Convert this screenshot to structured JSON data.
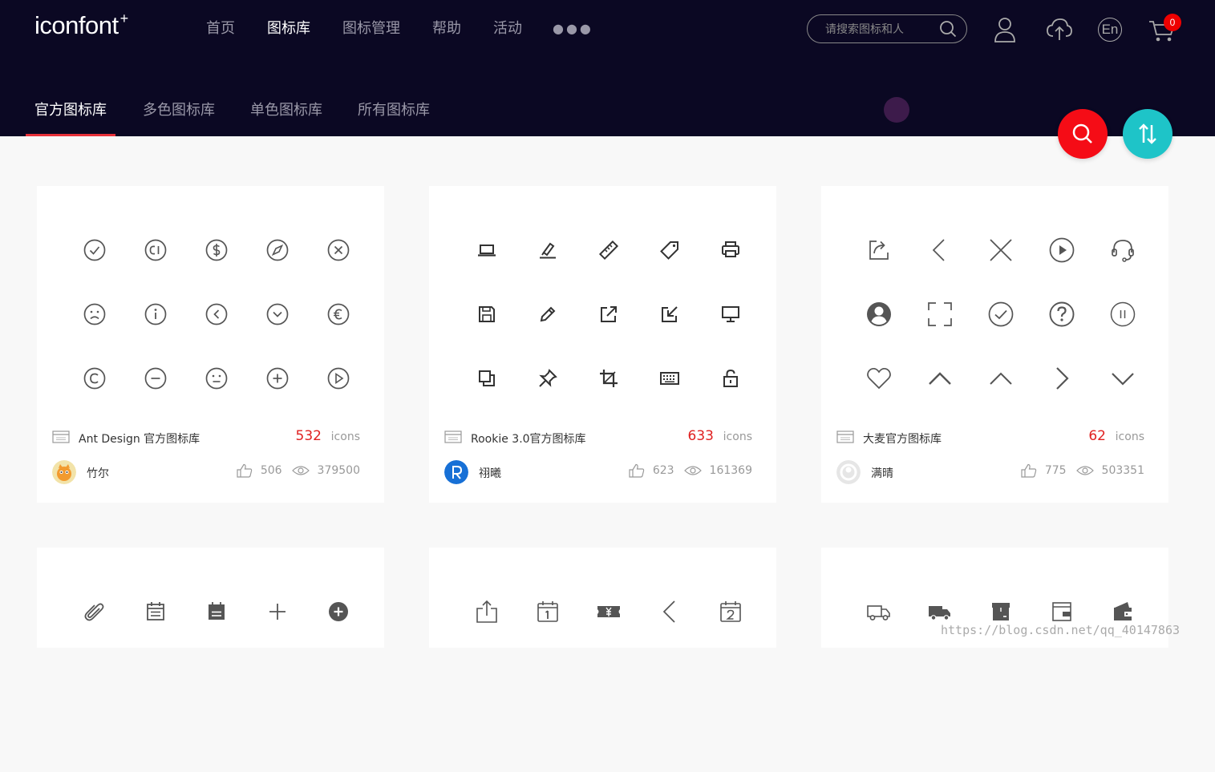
{
  "header": {
    "logo": "iconfont",
    "logo_sup": "+",
    "nav": [
      "首页",
      "图标库",
      "图标管理",
      "帮助",
      "活动"
    ],
    "nav_more": "●●●",
    "search_placeholder": "请搜索图标和人",
    "lang_label": "En",
    "cart_count": "0",
    "subnav": [
      "官方图标库",
      "多色图标库",
      "单色图标库",
      "所有图标库"
    ]
  },
  "cards": [
    {
      "name": "Ant Design 官方图标库",
      "count": "532",
      "count_unit": "icons",
      "author": "竹尔",
      "likes": "506",
      "views": "379500"
    },
    {
      "name": "Rookie 3.0官方图标库",
      "count": "633",
      "count_unit": "icons",
      "author": "祤曦",
      "likes": "623",
      "views": "161369"
    },
    {
      "name": "大麦官方图标库",
      "count": "62",
      "count_unit": "icons",
      "author": "满晴",
      "likes": "775",
      "views": "503351"
    }
  ],
  "watermark": "https://blog.csdn.net/qq_40147863",
  "colors": {
    "header_bg": "#0b0823",
    "accent_red": "#e02020",
    "fab_search": "#f50c16",
    "fab_sort": "#1ec4c8"
  }
}
